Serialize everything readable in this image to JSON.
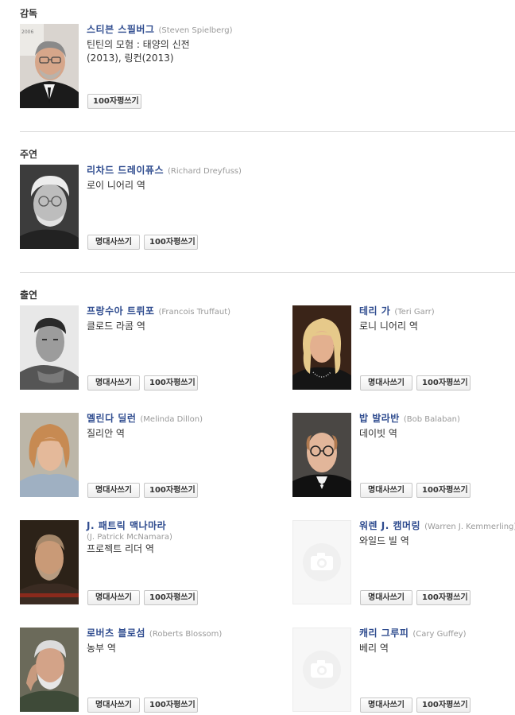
{
  "sections": {
    "director": {
      "title": "감독"
    },
    "lead": {
      "title": "주연"
    },
    "cast": {
      "title": "출연"
    }
  },
  "buttons": {
    "quote": "명대사쓰기",
    "review": "100자평쓰기"
  },
  "people": {
    "spielberg": {
      "name": "스티븐 스필버그",
      "eng": "(Steven Spielberg)",
      "role1": "틴틴의 모험 : 태양의 신전",
      "role2": "(2013), 링컨(2013)",
      "photo_text": "2006"
    },
    "dreyfuss": {
      "name": "리차드 드레이퓨스",
      "eng": "(Richard Dreyfuss)",
      "role": "로이 니어리 역"
    },
    "truffaut": {
      "name": "프랑수아 트뤼포",
      "eng": "(Francois Truffaut)",
      "role": "클로드 라콤 역"
    },
    "garr": {
      "name": "테리 가",
      "eng": "(Teri Garr)",
      "role": "로니 니어리 역"
    },
    "dillon": {
      "name": "멜린다 딜런",
      "eng": "(Melinda Dillon)",
      "role": "질리안 역"
    },
    "balaban": {
      "name": "밥 발라반",
      "eng": "(Bob Balaban)",
      "role": "데이빗 역"
    },
    "mcnamara": {
      "name": "J. 패트릭 맥나마라",
      "eng": "(J. Patrick McNamara)",
      "role": "프로젝트 리더 역"
    },
    "kemmerling": {
      "name": "워렌 J. 캠머링",
      "eng": "(Warren J. Kemmerling)",
      "role": "와일드 빌 역"
    },
    "blossom": {
      "name": "로버츠 블로섬",
      "eng": "(Roberts Blossom)",
      "role": "농부 역"
    },
    "guffey": {
      "name": "캐리 그루피",
      "eng": "(Cary Guffey)",
      "role": "베리 역"
    }
  }
}
